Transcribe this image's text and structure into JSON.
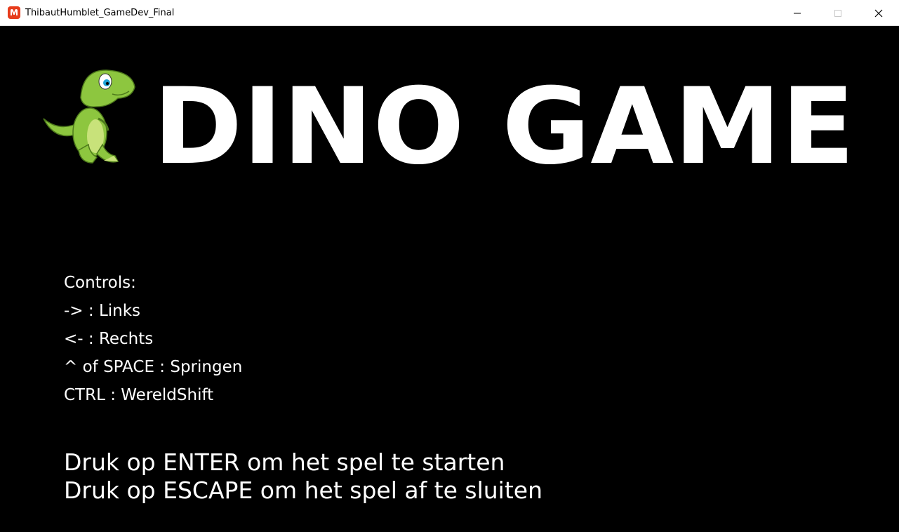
{
  "window": {
    "title": "ThibautHumblet_GameDev_Final",
    "app_icon": "monogame-icon",
    "controls": [
      "minimize-icon",
      "maximize-icon",
      "close-icon"
    ]
  },
  "logo": {
    "text": "DINO GAME",
    "mascot": "dino-mascot"
  },
  "controls": {
    "heading": "Controls:",
    "items": [
      "-> : Links",
      "<- : Rechts",
      "^ of SPACE : Springen",
      "CTRL : WereldShift"
    ]
  },
  "prompts": {
    "start": "Druk op ENTER om het spel te starten",
    "quit": "Druk op ESCAPE om het spel af te sluiten"
  },
  "colors": {
    "background": "#000000",
    "text": "#ffffff",
    "dino_green": "#8dc63f",
    "app_icon": "#e73c1c"
  }
}
